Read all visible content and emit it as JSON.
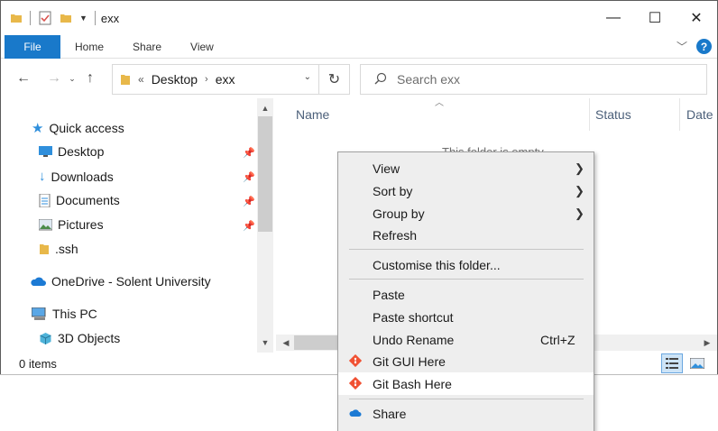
{
  "window": {
    "title": "exx",
    "controls": {
      "minimize": "—",
      "maximize": "☐",
      "close": "✕"
    }
  },
  "ribbon": {
    "tabs": [
      "File",
      "Home",
      "Share",
      "View"
    ]
  },
  "address": {
    "overflow": "«",
    "crumbs": [
      "Desktop",
      "exx"
    ]
  },
  "search": {
    "placeholder": "Search exx"
  },
  "navpane": {
    "items": [
      {
        "label": "Quick access",
        "icon": "star-icon"
      },
      {
        "label": "Desktop",
        "icon": "desktop-icon",
        "pinned": true
      },
      {
        "label": "Downloads",
        "icon": "download-icon",
        "pinned": true
      },
      {
        "label": "Documents",
        "icon": "document-icon",
        "pinned": true
      },
      {
        "label": "Pictures",
        "icon": "picture-icon",
        "pinned": true
      },
      {
        "label": ".ssh",
        "icon": "folder-icon",
        "pinned": false
      },
      {
        "label": "OneDrive - Solent University",
        "icon": "cloud-icon"
      },
      {
        "label": "This PC",
        "icon": "computer-icon"
      },
      {
        "label": "3D Objects",
        "icon": "cube-icon"
      }
    ]
  },
  "columns": [
    "Name",
    "Status",
    "Date"
  ],
  "empty_message": "This folder is empty.",
  "status": {
    "count": "0 items"
  },
  "context_menu": {
    "items": [
      {
        "label": "View",
        "submenu": true
      },
      {
        "label": "Sort by",
        "submenu": true
      },
      {
        "label": "Group by",
        "submenu": true
      },
      {
        "label": "Refresh"
      },
      {
        "label": "Customise this folder..."
      },
      {
        "label": "Paste"
      },
      {
        "label": "Paste shortcut"
      },
      {
        "label": "Undo Rename",
        "accelerator": "Ctrl+Z"
      },
      {
        "label": "Git GUI Here",
        "icon": "git-icon"
      },
      {
        "label": "Git Bash Here",
        "icon": "git-icon"
      },
      {
        "label": "Share",
        "icon": "onedrive-icon"
      }
    ]
  },
  "colors": {
    "accent": "#1979ca",
    "folder": "#e8b84a",
    "menu_bg": "#eeeeee"
  }
}
